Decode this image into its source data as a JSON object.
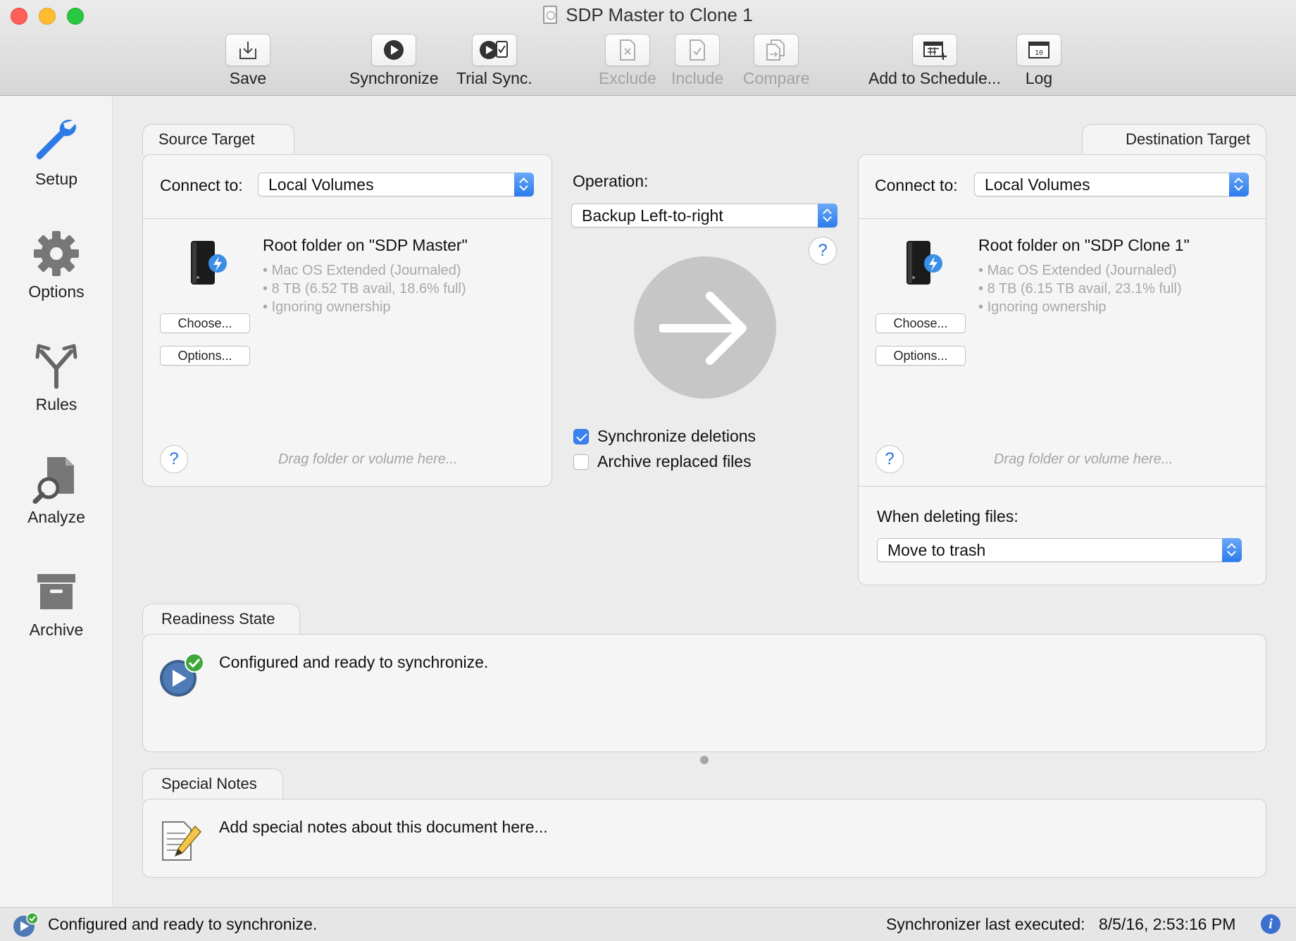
{
  "window": {
    "title": "SDP Master to Clone 1"
  },
  "toolbar": {
    "save": "Save",
    "synchronize": "Synchronize",
    "trial_sync": "Trial Sync.",
    "exclude": "Exclude",
    "include": "Include",
    "compare": "Compare",
    "add_to_schedule": "Add to Schedule...",
    "log": "Log"
  },
  "sidebar": {
    "items": [
      {
        "label": "Setup",
        "icon": "wrench-icon",
        "selected": true
      },
      {
        "label": "Options",
        "icon": "gear-icon"
      },
      {
        "label": "Rules",
        "icon": "fork-arrows-icon"
      },
      {
        "label": "Analyze",
        "icon": "magnifier-document-icon"
      },
      {
        "label": "Archive",
        "icon": "archive-box-icon"
      }
    ]
  },
  "source": {
    "tab": "Source Target",
    "connect_label": "Connect to:",
    "connect_value": "Local Volumes",
    "volume_title": "Root folder on \"SDP Master\"",
    "details": [
      "Mac OS Extended (Journaled)",
      "8 TB (6.52 TB avail, 18.6% full)",
      "Ignoring ownership"
    ],
    "choose": "Choose...",
    "options": "Options...",
    "drag_hint": "Drag folder or volume here...",
    "help": "?"
  },
  "destination": {
    "tab": "Destination Target",
    "connect_label": "Connect to:",
    "connect_value": "Local Volumes",
    "volume_title": "Root folder on \"SDP Clone 1\"",
    "details": [
      "Mac OS Extended (Journaled)",
      "8 TB (6.15 TB avail, 23.1% full)",
      "Ignoring ownership"
    ],
    "choose": "Choose...",
    "options": "Options...",
    "drag_hint": "Drag folder or volume here...",
    "help": "?",
    "deleting_label": "When deleting files:",
    "deleting_value": "Move to trash"
  },
  "operation": {
    "label": "Operation:",
    "value": "Backup Left-to-right",
    "help": "?",
    "sync_deletions": {
      "label": "Synchronize deletions",
      "checked": true
    },
    "archive_replaced": {
      "label": "Archive replaced files",
      "checked": false
    }
  },
  "readiness": {
    "tab": "Readiness State",
    "message": "Configured and ready to synchronize."
  },
  "notes": {
    "tab": "Special Notes",
    "placeholder": "Add special notes about this document here..."
  },
  "status": {
    "message": "Configured and ready to synchronize.",
    "last_executed_label": "Synchronizer last executed:",
    "last_executed_value": "8/5/16, 2:53:16 PM"
  },
  "colors": {
    "accent": "#2c7bed",
    "arrow_circle": "#c6c6c6",
    "ready_green": "#3fa83a"
  }
}
